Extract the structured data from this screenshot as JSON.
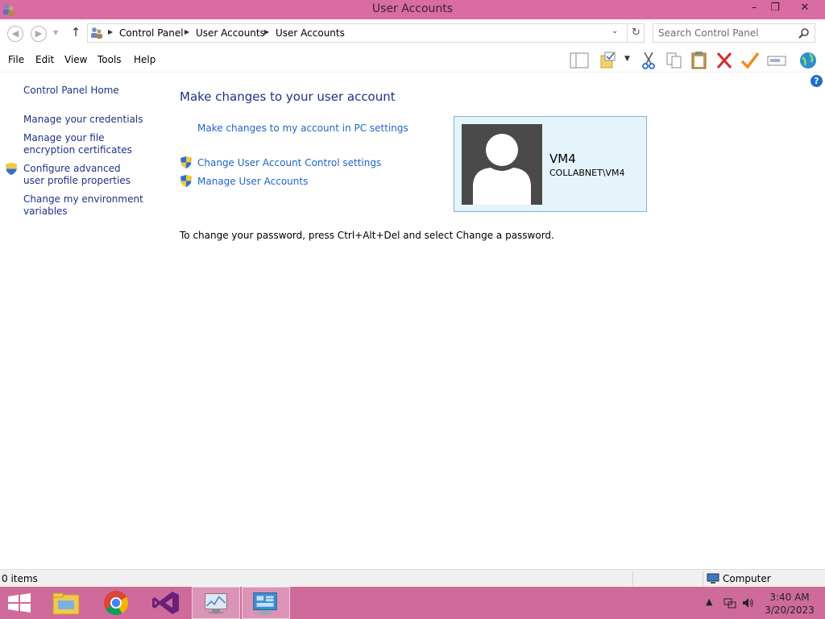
{
  "window": {
    "title": "User Accounts",
    "minimize": "–",
    "restore": "❐",
    "close": "✕"
  },
  "address": {
    "breadcrumbs": [
      "Control Panel",
      "User Accounts",
      "User Accounts"
    ],
    "search_placeholder": "Search Control Panel"
  },
  "menu": [
    "File",
    "Edit",
    "View",
    "Tools",
    "Help"
  ],
  "toolbar_icons": [
    "layout-pane-icon",
    "properties-folder-icon",
    "cut-icon",
    "copy-icon",
    "paste-icon",
    "delete-icon",
    "checkmark-icon",
    "rename-icon",
    "globe-icon"
  ],
  "left_pane": {
    "home": "Control Panel Home",
    "credentials": "Manage your credentials",
    "encryption": "Manage your file encryption certificates",
    "advanced_profile": "Configure advanced user profile properties",
    "environment": "Change my environment variables"
  },
  "main": {
    "heading": "Make changes to your user account",
    "pc_settings_link": "Make changes to my account in PC settings",
    "uac_link": "Change User Account Control settings",
    "manage_link": "Manage User Accounts",
    "password_note": "To change your password, press Ctrl+Alt+Del and select Change a password."
  },
  "user": {
    "name": "VM4",
    "domain": "COLLABNET\\VM4"
  },
  "status": {
    "items": "0 items",
    "location": "Computer"
  },
  "taskbar": {
    "time": "3:40 AM",
    "date": "3/20/2023"
  },
  "colors": {
    "titlebar": "#d96ca3",
    "taskbar": "#cf6b9a",
    "link": "#1e64c8",
    "heading": "#1e3287",
    "tile_bg": "#e5f3fb",
    "tile_border": "#7fb3d5"
  }
}
